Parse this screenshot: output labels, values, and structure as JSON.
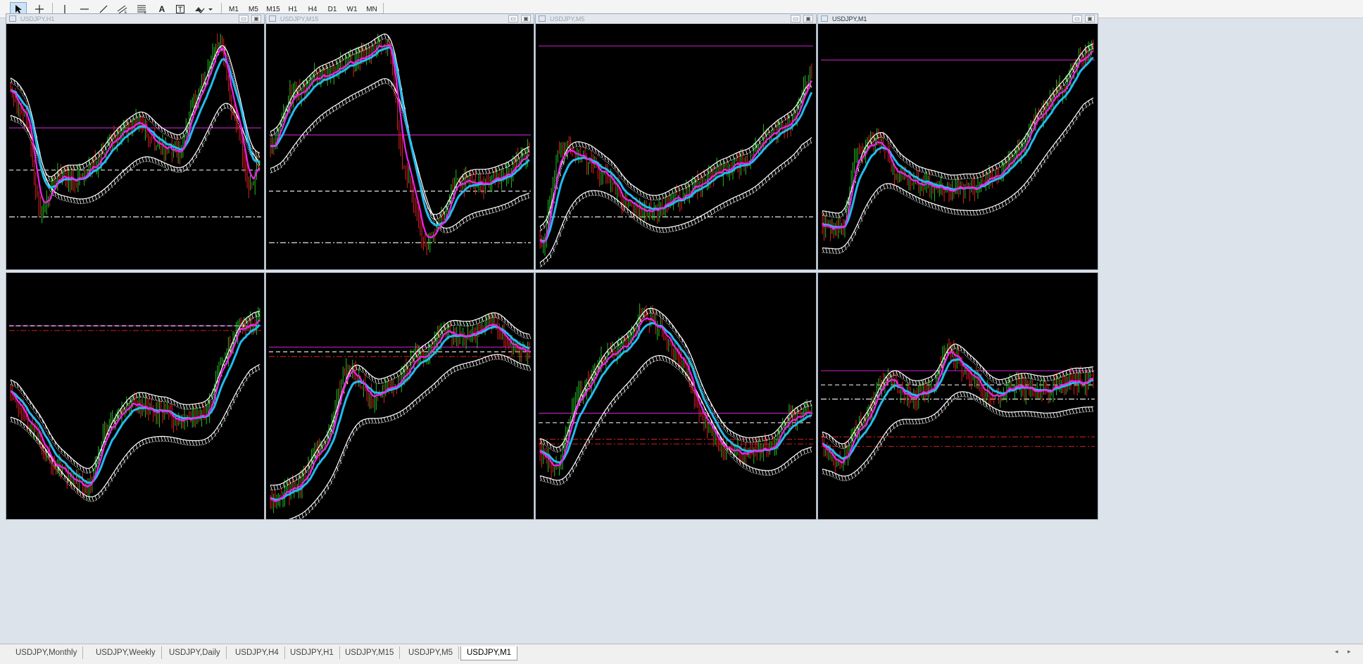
{
  "toolbar": {
    "tools": [
      "cursor-icon",
      "crosshair-icon",
      "vertical-line-icon",
      "horizontal-line-icon",
      "trendline-icon",
      "channel-icon",
      "fibonacci-icon",
      "text-icon",
      "text-label-icon",
      "shapes-icon"
    ],
    "text_tool_label": "A",
    "timeframes": [
      "M1",
      "M5",
      "M15",
      "H1",
      "H4",
      "D1",
      "W1",
      "MN"
    ]
  },
  "windows": [
    {
      "title": "USDJPY,H1",
      "active": false
    },
    {
      "title": "USDJPY,M15",
      "active": false
    },
    {
      "title": "USDJPY,M5",
      "active": false
    },
    {
      "title": "USDJPY,M1",
      "active": true
    }
  ],
  "tabs": [
    "USDJPY,Monthly",
    "USDJPY,Weekly",
    "USDJPY,Daily",
    "USDJPY,H4",
    "USDJPY,H1",
    "USDJPY,M15",
    "USDJPY,M5",
    "USDJPY,M1"
  ],
  "active_tab": "USDJPY,M1",
  "colors": {
    "background": "#000000",
    "bull_candle": "#22c022",
    "bear_candle": "#dd2020",
    "fast_ma": "#ee22ee",
    "slow_ma": "#22bbee",
    "envelope": "#ffffff",
    "level_magenta": "#cc22cc",
    "level_red": "#cc2020"
  }
}
